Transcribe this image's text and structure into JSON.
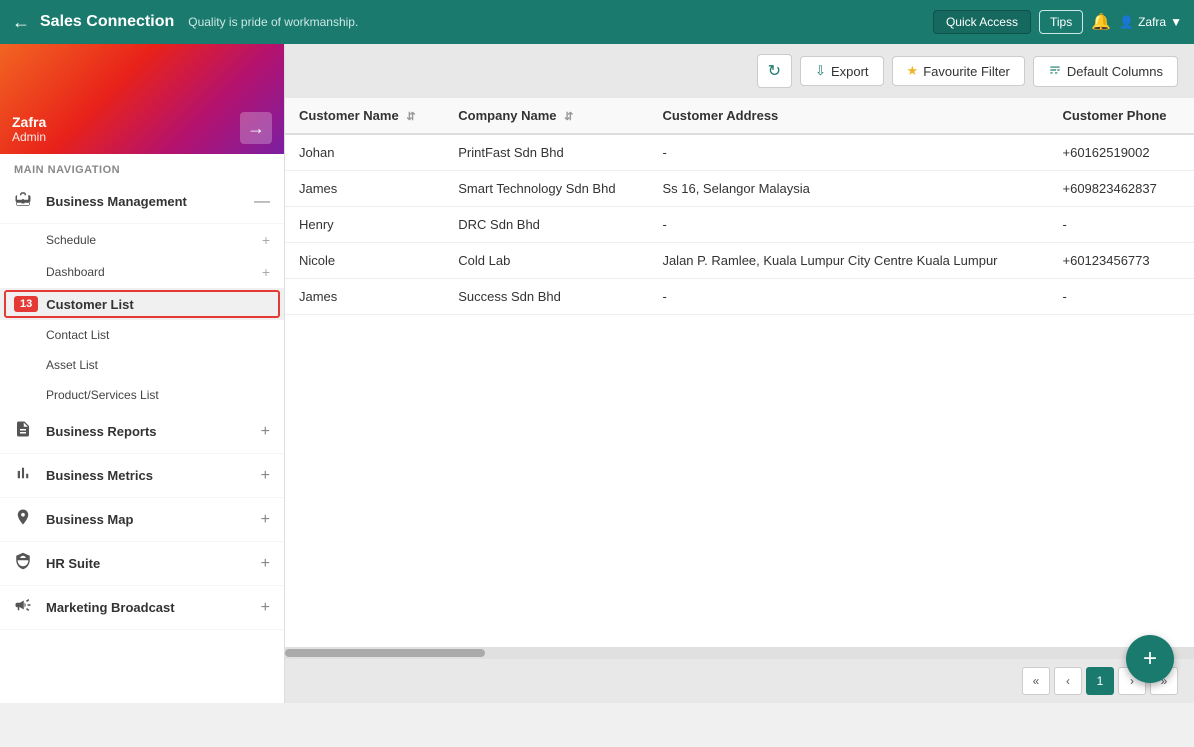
{
  "app": {
    "title": "Sales Connection",
    "subtitle": "Quality is pride of workmanship.",
    "quick_access_label": "Quick Access",
    "tips_label": "Tips",
    "user_name": "Zafra"
  },
  "sidebar": {
    "user": {
      "name": "Zafra",
      "role": "Admin"
    },
    "logout_icon": "⇥",
    "nav_label": "MAIN NAVIGATION",
    "items": [
      {
        "label": "Business Management",
        "icon": "🗄",
        "action": "—"
      },
      {
        "label": "Schedule",
        "icon": "",
        "action": "+"
      },
      {
        "label": "Dashboard",
        "icon": "",
        "action": "+"
      },
      {
        "label": "Customer List",
        "badge": "13",
        "active": true
      },
      {
        "label": "Contact List",
        "icon": ""
      },
      {
        "label": "Asset List",
        "icon": ""
      },
      {
        "label": "Product/Services List",
        "icon": ""
      },
      {
        "label": "Business Reports",
        "icon": "📋",
        "action": "+"
      },
      {
        "label": "Business Metrics",
        "icon": "📊",
        "action": "+"
      },
      {
        "label": "Business Map",
        "icon": "📍",
        "action": "+"
      },
      {
        "label": "HR Suite",
        "icon": "🏛",
        "action": "+"
      },
      {
        "label": "Marketing Broadcast",
        "icon": "📢",
        "action": "+"
      }
    ]
  },
  "toolbar": {
    "refresh_title": "Refresh",
    "export_label": "Export",
    "favourite_filter_label": "Favourite Filter",
    "default_columns_label": "Default Columns"
  },
  "table": {
    "columns": [
      {
        "label": "Customer Name",
        "sortable": true
      },
      {
        "label": "Company Name",
        "sortable": true
      },
      {
        "label": "Customer Address",
        "sortable": false
      },
      {
        "label": "Customer Phone",
        "sortable": false
      }
    ],
    "rows": [
      {
        "name": "Johan",
        "company": "PrintFast Sdn Bhd",
        "address": "-",
        "phone": "+60162519002"
      },
      {
        "name": "James",
        "company": "Smart Technology Sdn Bhd",
        "address": "Ss 16, Selangor Malaysia",
        "phone": "+609823462837"
      },
      {
        "name": "Henry",
        "company": "DRC Sdn Bhd",
        "address": "-",
        "phone": "-"
      },
      {
        "name": "Nicole",
        "company": "Cold Lab",
        "address": "Jalan P. Ramlee, Kuala Lumpur City Centre Kuala Lumpur",
        "phone": "+60123456773"
      },
      {
        "name": "James",
        "company": "Success Sdn Bhd",
        "address": "-",
        "phone": "-"
      }
    ]
  },
  "pagination": {
    "first_label": "«",
    "prev_label": "‹",
    "current": "1",
    "next_label": "›",
    "last_label": "»"
  },
  "fab": {
    "label": "+"
  }
}
